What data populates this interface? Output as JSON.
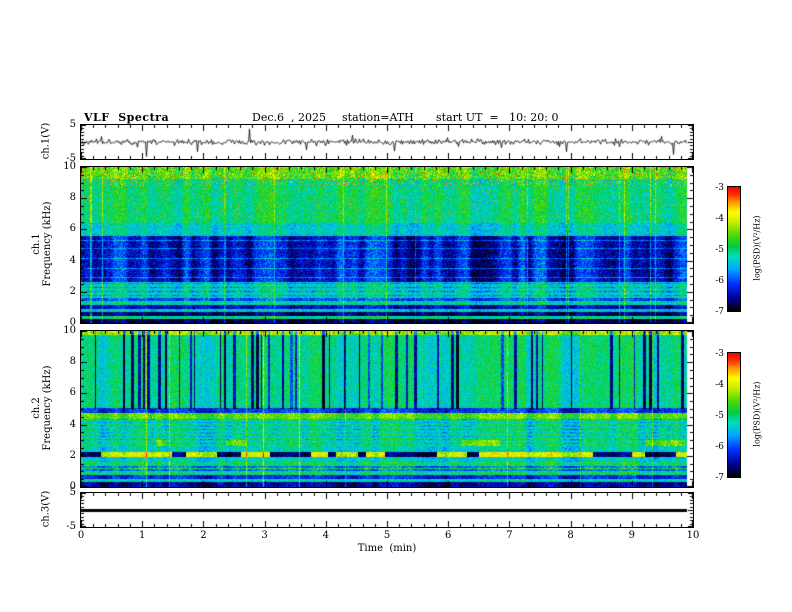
{
  "header": {
    "title": "VLF  Spectra",
    "date": "Dec.6  , 2025",
    "station": "station=ATH",
    "start_ut": "start UT  =   10: 20: 0"
  },
  "axes": {
    "x": {
      "label": "Time  (min)",
      "min": 0,
      "max": 10,
      "major_ticks": [
        0,
        1,
        2,
        3,
        4,
        5,
        6,
        7,
        8,
        9,
        10
      ],
      "minor_step": 0.2
    },
    "freq": {
      "min": 0,
      "max": 10,
      "unit": "kHz",
      "major_ticks": [
        10,
        8,
        6,
        4,
        2,
        0
      ],
      "minor_step": 0.5
    },
    "volt": {
      "min": -5,
      "max": 5,
      "tick_labels": [
        "5",
        "-5"
      ]
    }
  },
  "panels": {
    "ch1_wave": {
      "ylabel": "ch.1(V)"
    },
    "ch1_spec": {
      "ylabel_line1": "ch.1",
      "ylabel_line2": "Frequency  (kHz)"
    },
    "ch2_spec": {
      "ylabel_line1": "ch.2",
      "ylabel_line2": "Frequency  (kHz)"
    },
    "ch3_wave": {
      "ylabel": "ch.3(V)"
    }
  },
  "colorbar": {
    "label": "log(PSD)(V²/Hz)",
    "ticks": [
      "-3",
      "-4",
      "-5",
      "-6",
      "-7"
    ],
    "vmin": -7,
    "vmax": -3,
    "stops": [
      [
        0,
        "#000000"
      ],
      [
        0.1,
        "#000099"
      ],
      [
        0.22,
        "#0033ff"
      ],
      [
        0.34,
        "#00aaff"
      ],
      [
        0.44,
        "#00ddbb"
      ],
      [
        0.52,
        "#00cc44"
      ],
      [
        0.62,
        "#55dd00"
      ],
      [
        0.72,
        "#ccee00"
      ],
      [
        0.8,
        "#ffff00"
      ],
      [
        0.88,
        "#ff9900"
      ],
      [
        0.94,
        "#ff3300"
      ],
      [
        1,
        "#ff0000"
      ]
    ]
  },
  "chart_data": [
    {
      "type": "line",
      "name": "ch.1 voltage waveform",
      "ylabel": "ch.1(V)",
      "ylim": [
        -5,
        5
      ],
      "xlim": [
        0,
        10
      ],
      "xlabel": "Time (min)",
      "summary": "Broadband noise centred on 0 V with frequent impulsive spikes, mostly downward, reaching about -4 V and occasionally +2 V.",
      "render": {
        "seed": 11,
        "noise_sd": 0.38,
        "spike_prob": 0.05
      }
    },
    {
      "type": "heatmap",
      "name": "ch.1 VLF spectrogram",
      "ylabel": "ch.1 Frequency (kHz)",
      "ylim": [
        0,
        10
      ],
      "xlim": [
        0,
        10
      ],
      "zlim": [
        -7,
        -3
      ],
      "zlabel": "log(PSD)(V²/Hz)",
      "summary": "Strong yellow/red power above ~6 kHz peaking toward 10 kHz with red speckle; deep quiet navy band ~2.6-5.5 kHz crossed by faint cyan horizontal lines and lighter vertical streaks; striped moderate band 1.6-2.6 kHz; dark bands with narrow green lines below 1.5 kHz; occasional bright full-height vertical streaks.",
      "render": {
        "seed": 21,
        "speckle": 0.38,
        "bright_prob": 0.035,
        "bands": [
          [
            0,
            0.28,
            -6.8
          ],
          [
            0.28,
            0.45,
            -5.1
          ],
          [
            0.45,
            0.72,
            -6.7
          ],
          [
            0.72,
            0.92,
            -5.4
          ],
          [
            0.92,
            1.18,
            -6.4
          ],
          [
            1.18,
            1.4,
            -5.2
          ],
          [
            1.4,
            1.58,
            -6.0
          ],
          [
            1.58,
            2.62,
            -5.3
          ],
          [
            2.62,
            5.55,
            -6.35
          ],
          [
            5.55,
            6.4,
            -5.3
          ],
          [
            6.4,
            9.2,
            -5.0
          ],
          [
            9.2,
            10.01,
            -4.55
          ]
        ],
        "lines": [
          [
            2.95,
            -5.75
          ],
          [
            3.5,
            -5.7
          ],
          [
            4.15,
            -5.75
          ],
          [
            4.8,
            -5.8
          ],
          [
            5.3,
            -5.75
          ]
        ],
        "stripe": [
          1.58,
          2.62,
          0.26,
          0.35
        ],
        "blueband": [
          2.62,
          5.55
        ],
        "hot": {
          "fmin": 8.8,
          "speckle": 0.55,
          "prob": 0.06
        },
        "red_dots": [
          6.5,
          0.012
        ]
      }
    },
    {
      "type": "heatmap",
      "name": "ch.2 VLF spectrogram",
      "ylabel": "ch.2 Frequency (kHz)",
      "ylim": [
        0,
        10
      ],
      "xlim": [
        0,
        10
      ],
      "zlim": [
        -7,
        -3
      ],
      "zlabel": "log(PSD)(V²/Hz)",
      "summary": "Mostly green moderate power; many narrow dark-blue vertical dropouts above ~5 kHz; bright yellow band ~4.4-4.75 kHz above a dark line near 4.9 kHz; intermittent yellow/dark band near 2 kHz; orange patches near 2.8 kHz; fine horizontal striping 2.6-4.4 kHz; layered narrow bands below 1.6 kHz; thin hot edge at 10 kHz.",
      "render": {
        "seed": 33,
        "speckle": 0.35,
        "bright_prob": 0.02,
        "bands": [
          [
            0,
            0.3,
            -6.6
          ],
          [
            0.3,
            0.5,
            -5.3
          ],
          [
            0.5,
            0.8,
            -6.3
          ],
          [
            0.8,
            1.05,
            -5.1
          ],
          [
            1.05,
            1.35,
            -5.9
          ],
          [
            1.35,
            1.6,
            -5.0
          ],
          [
            1.6,
            1.95,
            -5.4
          ],
          [
            2.25,
            2.6,
            -5.35
          ],
          [
            3.0,
            4.35,
            -5.25
          ],
          [
            4.35,
            4.75,
            -4.55
          ],
          [
            4.75,
            5.05,
            -6.2
          ],
          [
            5.05,
            9.75,
            -5.15
          ],
          [
            9.75,
            10.01,
            -4.3
          ]
        ],
        "lines": [
          [
            1.22,
            -4.8
          ]
        ],
        "stripe": [
          2.6,
          4.4,
          0.22,
          0.3
        ],
        "dark_streaks": {
          "fmin": 5.0,
          "prob": 0.08,
          "depth": -1.55
        },
        "gates": [
          {
            "f": [
              1.95,
              2.25
            ],
            "on": -4.05,
            "off": -6.8,
            "thresh": -0.25,
            "scale": 14,
            "seed": 7
          },
          {
            "f": [
              2.6,
              3.0
            ],
            "on": -4.5,
            "off": null,
            "thresh": 0.35,
            "scale": 26,
            "seed": 8
          }
        ],
        "hot": {
          "fmin": 9.8,
          "speckle": 0.5,
          "prob": 0.05
        }
      }
    },
    {
      "type": "line",
      "name": "ch.3 voltage waveform",
      "ylabel": "ch.3(V)",
      "ylim": [
        -5,
        5
      ],
      "xlim": [
        0,
        10
      ],
      "summary": "Constant 0 V — flat thick black line across the whole record (channel inactive).",
      "render": {
        "flat": true,
        "value": 0,
        "thickness_px": 3,
        "seed": 5
      }
    }
  ]
}
